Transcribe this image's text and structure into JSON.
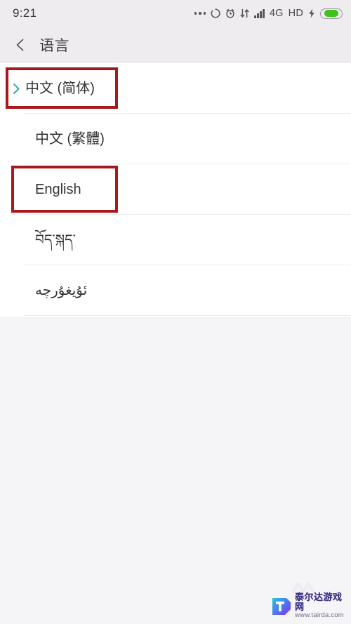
{
  "status_bar": {
    "time": "9:21",
    "icons": [
      {
        "name": "more-dots-icon",
        "label": "..."
      },
      {
        "name": "sync-circle-icon",
        "label": ""
      },
      {
        "name": "alarm-clock-icon",
        "label": ""
      },
      {
        "name": "data-transfer-icon",
        "label": ""
      },
      {
        "name": "signal-bars-icon",
        "label": ""
      },
      {
        "name": "network-type-label",
        "label": "4G"
      },
      {
        "name": "hd-voice-label",
        "label": "HD"
      },
      {
        "name": "charging-bolt-icon",
        "label": ""
      },
      {
        "name": "battery-icon",
        "label": ""
      }
    ],
    "network_type": "4G",
    "hd_label": "HD",
    "battery_level_percent": 74,
    "battery_color": "#3fc21f"
  },
  "app_bar": {
    "back_label": "返回",
    "title": "语言"
  },
  "language_list": {
    "items": [
      {
        "label": "中文 (简体)",
        "selected": true,
        "rtl": false
      },
      {
        "label": "中文 (繁體)",
        "selected": false,
        "rtl": false
      },
      {
        "label": "English",
        "selected": false,
        "rtl": false
      },
      {
        "label": "བོད་སྐད་",
        "selected": false,
        "rtl": false
      },
      {
        "label": "ئۇيغۇرچە",
        "selected": false,
        "rtl": true
      }
    ]
  },
  "annotations": [
    {
      "name": "highlight-box-simplified-chinese",
      "target": "中文 (简体)",
      "color": "#a8191d"
    },
    {
      "name": "highlight-box-english",
      "target": "English",
      "color": "#a8191d"
    }
  ],
  "watermark": {
    "site_name": "泰尔达游戏网",
    "url": "www.tairda.com"
  },
  "colors": {
    "chevron_teal": "#3fa9b5",
    "annotation_red": "#a8191d",
    "header_bg": "#eeecef",
    "page_bg": "#f5f4f7",
    "list_bg": "#ffffff",
    "text_primary": "#333333"
  }
}
